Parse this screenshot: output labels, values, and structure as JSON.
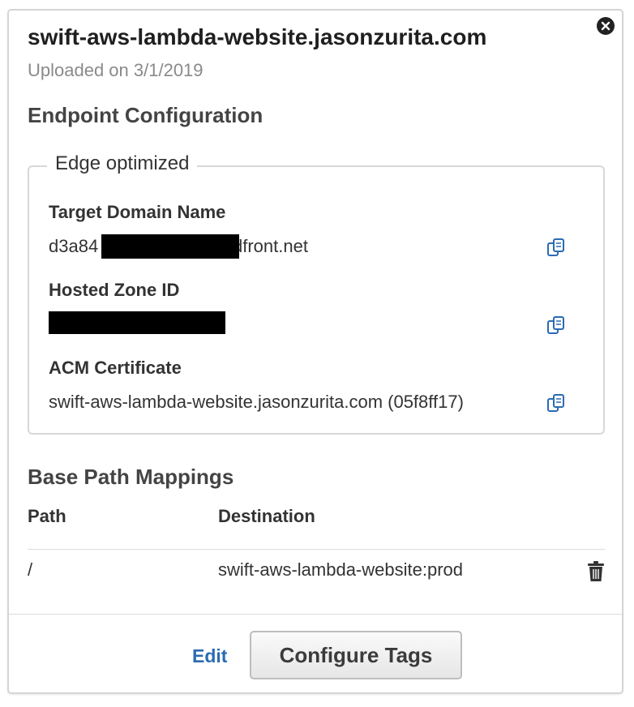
{
  "panel": {
    "title": "swift-aws-lambda-website.jasonzurita.com",
    "uploaded": "Uploaded on 3/1/2019",
    "close_icon": "close-circle-icon"
  },
  "endpoint": {
    "heading": "Endpoint Configuration",
    "type_legend": "Edge optimized",
    "fields": [
      {
        "label": "Target Domain Name",
        "value_prefix": "d3a84",
        "value_suffix": "dfront.net",
        "redacted": true
      },
      {
        "label": "Hosted Zone ID",
        "value": "",
        "redacted": true
      },
      {
        "label": "ACM Certificate",
        "value": "swift-aws-lambda-website.jasonzurita.com (05f8ff17)"
      }
    ],
    "copy_icon": "copy-icon",
    "accent_color": "#2a6bb3"
  },
  "mappings": {
    "heading": "Base Path Mappings",
    "columns": [
      "Path",
      "Destination"
    ],
    "rows": [
      {
        "path": "/",
        "destination": "swift-aws-lambda-website:prod"
      }
    ],
    "delete_icon": "trash-icon"
  },
  "footer": {
    "edit_label": "Edit",
    "configure_label": "Configure Tags"
  }
}
